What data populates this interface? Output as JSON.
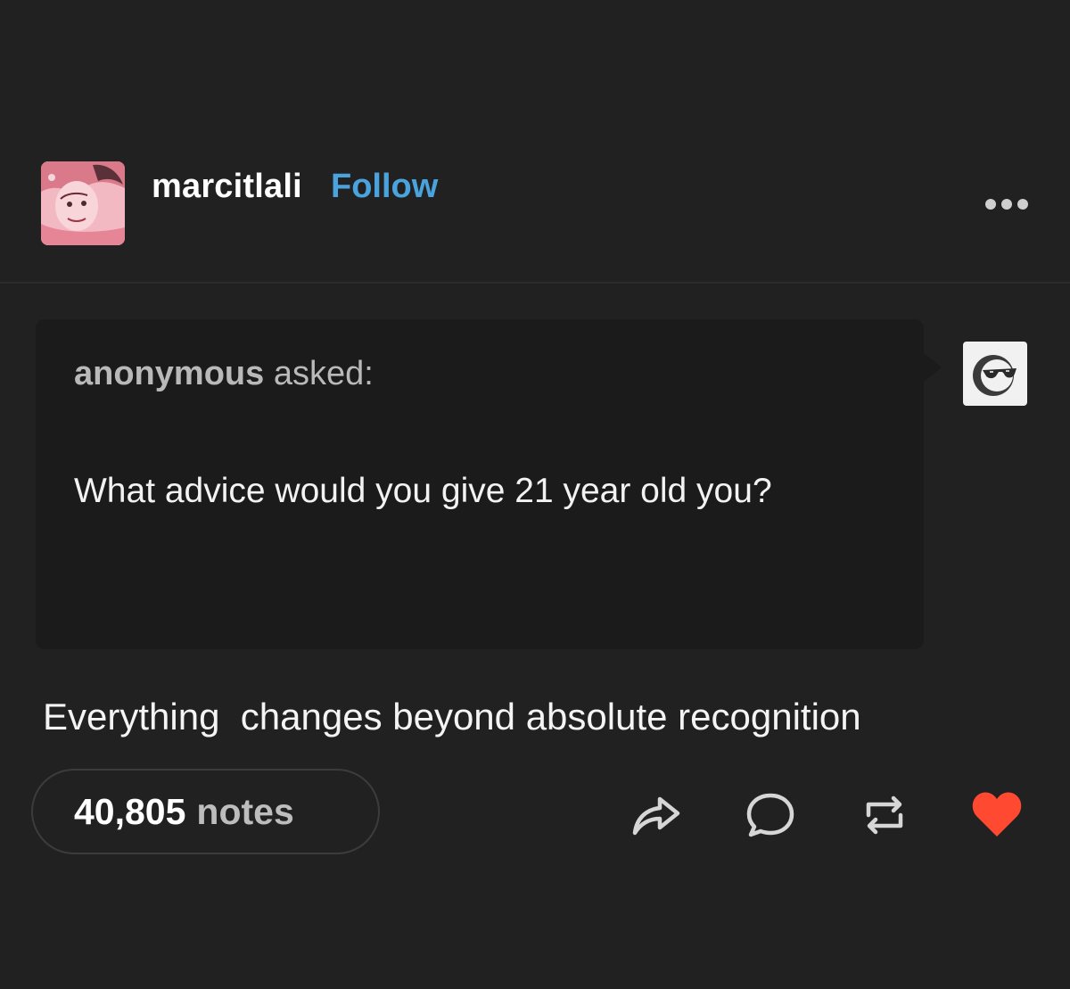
{
  "post": {
    "blog_name": "marcitlali",
    "follow_label": "Follow",
    "more_icon": "more-dots-icon",
    "avatar_icon": "blog-avatar"
  },
  "ask": {
    "asker": "anonymous",
    "asked_label": "asked:",
    "question": "What advice would you give 21 year old you?",
    "asker_avatar_icon": "anonymous-sunglasses-icon"
  },
  "answer": {
    "text": "Everything  changes beyond absolute recognition"
  },
  "footer": {
    "notes_count": "40,805",
    "notes_label": "notes",
    "actions": [
      "share-icon",
      "reply-icon",
      "reblog-icon",
      "like-heart-icon"
    ]
  },
  "colors": {
    "background": "#212121",
    "ask_box": "#1b1b1b",
    "follow_accent": "#4aa3dc",
    "like_red": "#ff4930",
    "muted_text": "#b9b9b9"
  }
}
